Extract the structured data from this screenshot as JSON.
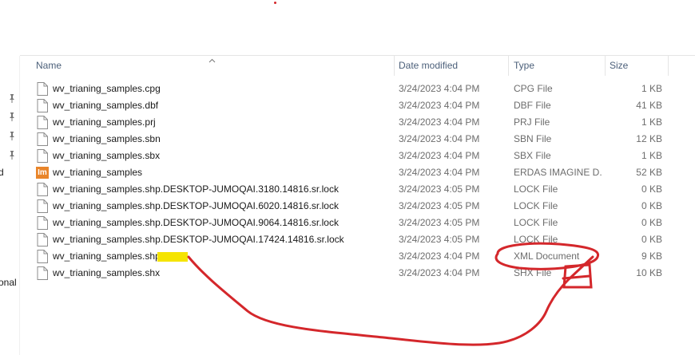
{
  "nav": {
    "pins": [
      "pin-icon",
      "pin-icon",
      "pin-icon",
      "pin-icon"
    ],
    "fragment_1": "d",
    "fragment_2": "onal"
  },
  "columns": {
    "name": "Name",
    "date": "Date modified",
    "type": "Type",
    "size": "Size"
  },
  "files": [
    {
      "name": "wv_trianing_samples.cpg",
      "date": "3/24/2023 4:04 PM",
      "type": "CPG File",
      "size": "1 KB",
      "icon": "document-icon"
    },
    {
      "name": "wv_trianing_samples.dbf",
      "date": "3/24/2023 4:04 PM",
      "type": "DBF File",
      "size": "41 KB",
      "icon": "document-icon"
    },
    {
      "name": "wv_trianing_samples.prj",
      "date": "3/24/2023 4:04 PM",
      "type": "PRJ File",
      "size": "1 KB",
      "icon": "document-icon"
    },
    {
      "name": "wv_trianing_samples.sbn",
      "date": "3/24/2023 4:04 PM",
      "type": "SBN File",
      "size": "12 KB",
      "icon": "document-icon"
    },
    {
      "name": "wv_trianing_samples.sbx",
      "date": "3/24/2023 4:04 PM",
      "type": "SBX File",
      "size": "1 KB",
      "icon": "document-icon"
    },
    {
      "name": "wv_trianing_samples",
      "date": "3/24/2023 4:04 PM",
      "type": "ERDAS IMAGINE D...",
      "size": "52 KB",
      "icon": "erdas-imagine-icon",
      "icon_text": "Im"
    },
    {
      "name": "wv_trianing_samples.shp.DESKTOP-JUMOQAI.3180.14816.sr.lock",
      "date": "3/24/2023 4:05 PM",
      "type": "LOCK File",
      "size": "0 KB",
      "icon": "document-icon"
    },
    {
      "name": "wv_trianing_samples.shp.DESKTOP-JUMOQAI.6020.14816.sr.lock",
      "date": "3/24/2023 4:05 PM",
      "type": "LOCK File",
      "size": "0 KB",
      "icon": "document-icon"
    },
    {
      "name": "wv_trianing_samples.shp.DESKTOP-JUMOQAI.9064.14816.sr.lock",
      "date": "3/24/2023 4:05 PM",
      "type": "LOCK File",
      "size": "0 KB",
      "icon": "document-icon"
    },
    {
      "name": "wv_trianing_samples.shp.DESKTOP-JUMOQAI.17424.14816.sr.lock",
      "date": "3/24/2023 4:05 PM",
      "type": "LOCK File",
      "size": "0 KB",
      "icon": "document-icon"
    },
    {
      "name": "wv_trianing_samples.shp",
      "date": "3/24/2023 4:04 PM",
      "type": "XML Document",
      "size": "9 KB",
      "icon": "document-icon"
    },
    {
      "name": "wv_trianing_samples.shx",
      "date": "3/24/2023 4:04 PM",
      "type": "SHX File",
      "size": "10 KB",
      "icon": "document-icon"
    }
  ],
  "colors": {
    "header_text": "#4c607a",
    "annotation_red": "#d4272b",
    "highlight_yellow": "#f5e400",
    "erdas_icon": "#e9852a"
  }
}
